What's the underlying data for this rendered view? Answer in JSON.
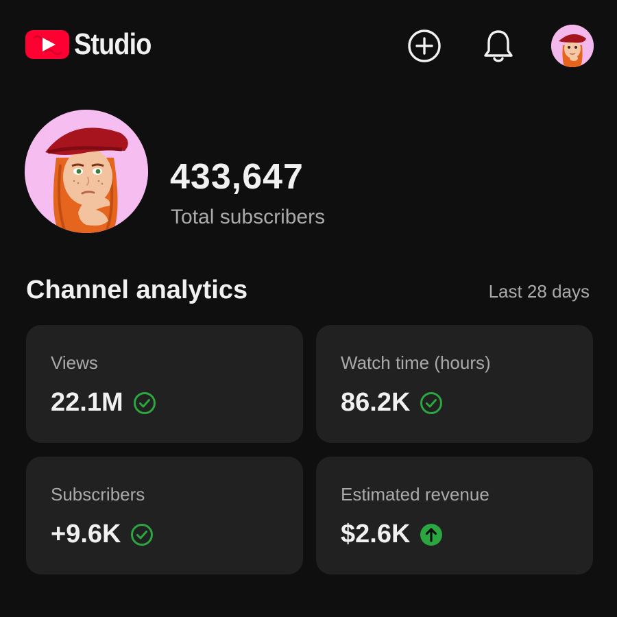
{
  "header": {
    "app_name": "Studio",
    "logo_icon": "youtube-play-logo",
    "create_icon": "plus-circle-icon",
    "notifications_icon": "bell-icon",
    "account_icon": "avatar"
  },
  "channel": {
    "subscriber_count": "433,647",
    "subscriber_label": "Total subscribers"
  },
  "analytics": {
    "title": "Channel analytics",
    "range": "Last 28 days",
    "cards": [
      {
        "label": "Views",
        "value": "22.1M",
        "status": "check-circle-icon"
      },
      {
        "label": "Watch time (hours)",
        "value": "86.2K",
        "status": "check-circle-icon"
      },
      {
        "label": "Subscribers",
        "value": "+9.6K",
        "status": "check-circle-icon"
      },
      {
        "label": "Estimated revenue",
        "value": "$2.6K",
        "status": "arrow-up-circle-icon"
      }
    ]
  },
  "colors": {
    "background": "#0f0f0f",
    "card": "#212121",
    "brand_red": "#ff0033",
    "status_green": "#2ba640",
    "text_primary": "#f1f1f1",
    "text_secondary": "#aaaaaa"
  }
}
